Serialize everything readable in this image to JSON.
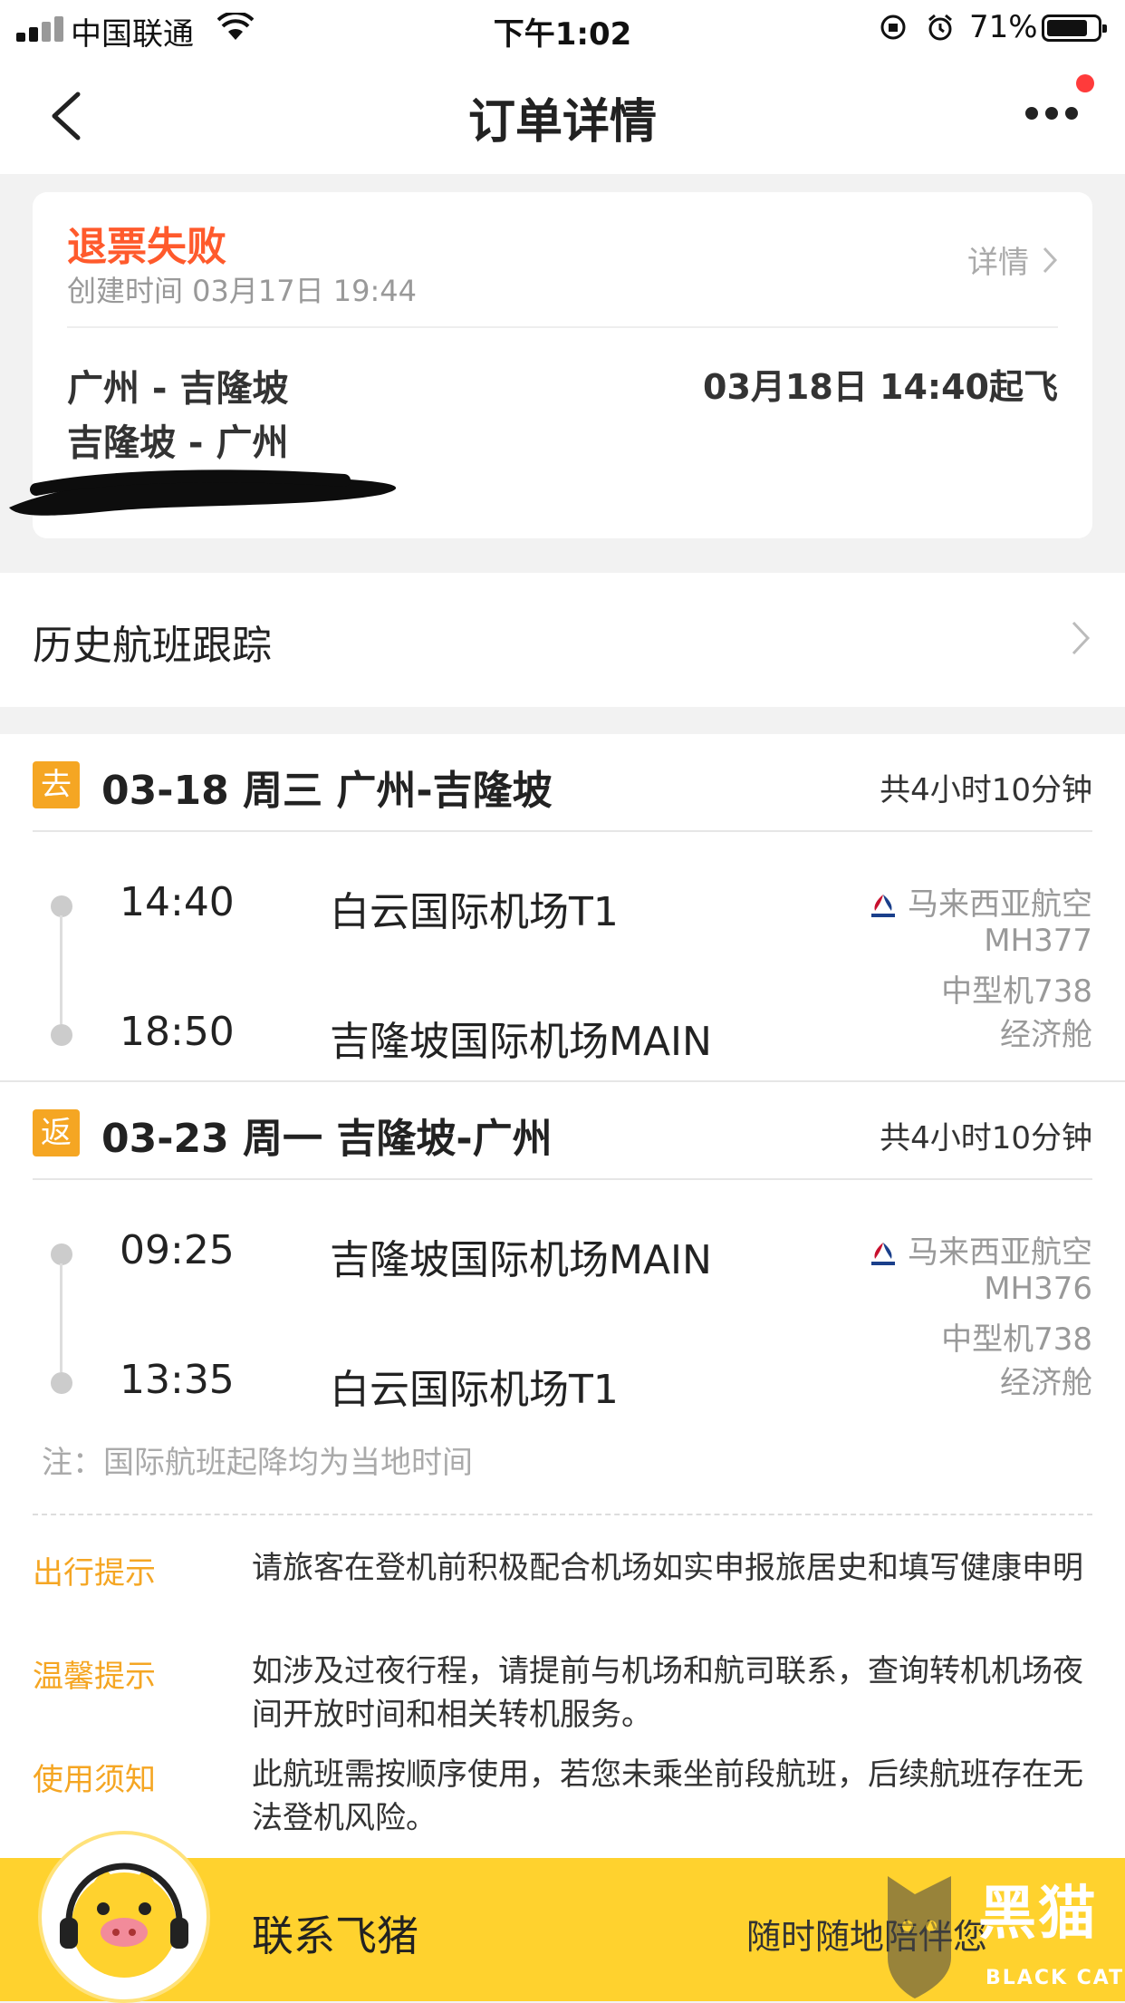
{
  "status_bar": {
    "carrier": "中国联通",
    "time": "下午1:02",
    "battery": "71%"
  },
  "nav": {
    "title": "订单详情"
  },
  "order": {
    "status": "退票失败",
    "created": "创建时间 03月17日 19:44",
    "detail_label": "详情",
    "route_out": "广州 - 吉隆坡",
    "route_back": "吉隆坡 - 广州",
    "depart_time": "03月18日 14:40起飞"
  },
  "history": {
    "label": "历史航班跟踪"
  },
  "segments": [
    {
      "tag": "去",
      "date_route": "03-18 周三 广州-吉隆坡",
      "duration": "共4小时10分钟",
      "dep_time": "14:40",
      "dep_airport": "白云国际机场T1",
      "arr_time": "18:50",
      "arr_airport": "吉隆坡国际机场MAIN",
      "airline": "马来西亚航空",
      "flight_no": "MH377",
      "aircraft": "中型机738",
      "cabin": "经济舱"
    },
    {
      "tag": "返",
      "date_route": "03-23 周一 吉隆坡-广州",
      "duration": "共4小时10分钟",
      "dep_time": "09:25",
      "dep_airport": "吉隆坡国际机场MAIN",
      "arr_time": "13:35",
      "arr_airport": "白云国际机场T1",
      "airline": "马来西亚航空",
      "flight_no": "MH376",
      "aircraft": "中型机738",
      "cabin": "经济舱"
    }
  ],
  "note": "注：国际航班起降均为当地时间",
  "tips": [
    {
      "title": "出行提示",
      "body": "请旅客在登机前积极配合机场如实申报旅居史和填写健康申明"
    },
    {
      "title": "温馨提示",
      "body": "如涉及过夜行程，请提前与机场和航司联系，查询转机机场夜间开放时间和相关转机服务。"
    },
    {
      "title": "使用须知",
      "body": "此航班需按顺序使用，若您未乘坐前段航班，后续航班存在无法登机风险。"
    }
  ],
  "bottom": {
    "contact": "联系飞猪",
    "anytime": "随时随地陪伴您"
  },
  "watermark": {
    "main": "黑猫",
    "sub": "BLACK CAT"
  },
  "colors": {
    "status_red": "#ff5a2c",
    "accent_orange": "#f5a623",
    "bottom_yellow": "#ffd22e"
  }
}
